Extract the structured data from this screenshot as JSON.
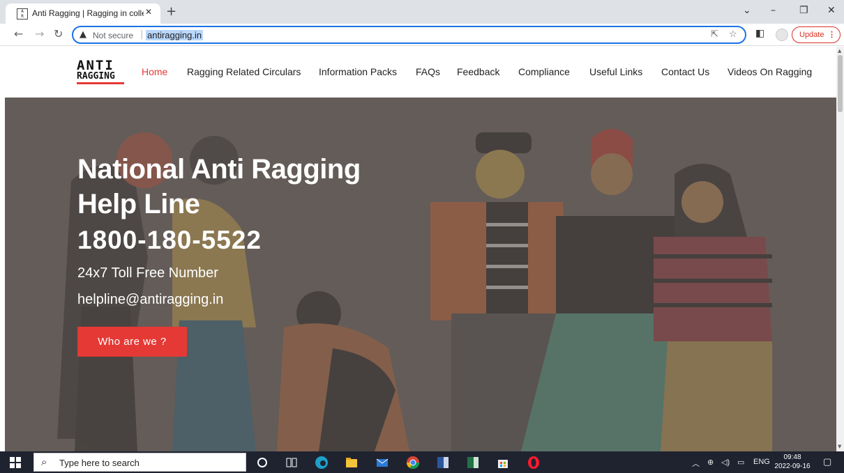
{
  "browser": {
    "tab_title": "Anti Ragging | Ragging in college",
    "tab_close": "✕",
    "new_tab": "+",
    "favicon_text": "ANTI RAG",
    "url_security": "Not secure",
    "url": "antiragging.in",
    "update_label": "Update",
    "window_controls": [
      "chevron-down-icon",
      "minimize-icon",
      "restore-icon",
      "close-icon"
    ]
  },
  "site": {
    "logo_line1": "ANTI",
    "logo_line2": "RAGGING",
    "nav": [
      "Home",
      "Ragging Related Circulars",
      "Information Packs",
      "FAQs",
      "Feedback",
      "Compliance",
      "Useful Links",
      "Contact Us",
      "Videos On Ragging"
    ],
    "active_nav": "Home",
    "accent_color": "#e53935"
  },
  "hero": {
    "title_line1": "National Anti Ragging",
    "title_line2": "Help Line",
    "phone": "1800-180-5522",
    "subtitle": "24x7 Toll Free Number",
    "email": "helpline@antiragging.in",
    "cta": "Who are we ?"
  },
  "taskbar": {
    "search_placeholder": "Type here to search",
    "language": "ENG",
    "time": "09:48",
    "date": "2022-09-16",
    "apps": [
      "cortana-icon",
      "task-view-icon",
      "edge-icon",
      "file-explorer-icon",
      "mail-icon",
      "chrome-icon",
      "word-icon",
      "excel-icon",
      "store-icon",
      "opera-icon"
    ]
  }
}
